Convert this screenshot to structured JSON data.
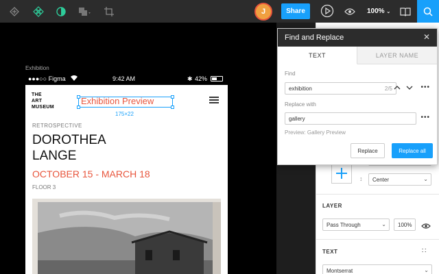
{
  "toolbar": {
    "icons": [
      "move-tool-icon",
      "component-icon",
      "mask-icon",
      "boolean-icon",
      "crop-icon"
    ],
    "avatar_initial": "J",
    "share_label": "Share",
    "zoom_label": "100%",
    "right_icons": [
      "play-icon",
      "eye-icon",
      "book-icon",
      "search-icon"
    ]
  },
  "canvas": {
    "frame_label": "Exhibition",
    "status": {
      "carrier": "●●●○○ Figma",
      "time": "9:42 AM",
      "battery": "42%"
    },
    "museum_logo": [
      "THE",
      "ART",
      "MUSEUM"
    ],
    "selected_text": "Exhibition Preview",
    "selected_dims": "175×22",
    "retrospective": "RETROSPECTIVE",
    "artist": [
      "DOROTHEA",
      "LANGE"
    ],
    "dates": "OCTOBER 15 - MARCH 18",
    "floor": "FLOOR 3"
  },
  "panel": {
    "align_value": "Center",
    "layer_heading": "LAYER",
    "blend_mode": "Pass Through",
    "opacity": "100%",
    "text_heading": "TEXT",
    "font_family": "Montserrat"
  },
  "dialog": {
    "title": "Find and Replace",
    "tabs": [
      "TEXT",
      "LAYER NAME"
    ],
    "find_label": "Find",
    "find_value": "exhibition",
    "find_count": "2/5",
    "replace_label": "Replace with",
    "replace_value": "gallery",
    "preview": "Preview: Gallery Preview",
    "replace_btn": "Replace",
    "replace_all_btn": "Replace all"
  },
  "colors": {
    "accent": "#18a0fb",
    "highlight": "#e8553c",
    "toolbar_bg": "#2c2c2c"
  }
}
